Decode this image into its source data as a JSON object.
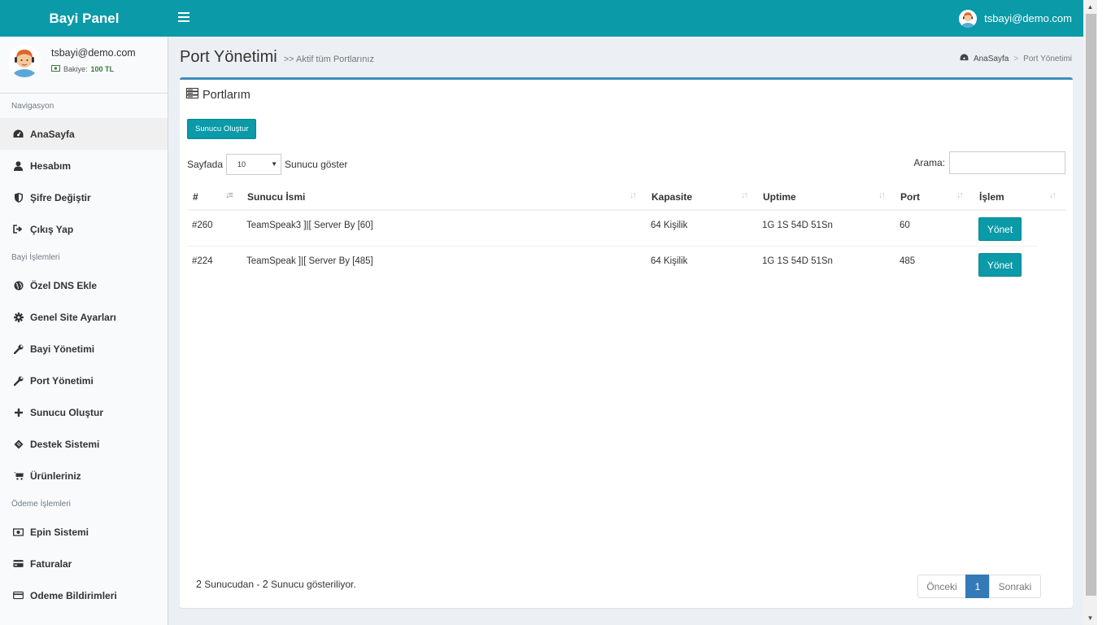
{
  "header": {
    "logo": "Bayi Panel",
    "user_email": "tsbayi@demo.com"
  },
  "sidebar": {
    "user": {
      "email": "tsbayi@demo.com",
      "balance_label": "Bakiye:",
      "balance_value": "100 TL"
    },
    "sections": [
      {
        "title": "Navigasyon",
        "items": [
          {
            "label": "AnaSayfa",
            "icon": "dashboard-icon",
            "active": true
          },
          {
            "label": "Hesabım",
            "icon": "user-icon"
          },
          {
            "label": "Şifre Değiştir",
            "icon": "shield-icon"
          },
          {
            "label": "Çıkış Yap",
            "icon": "sign-out-icon"
          }
        ]
      },
      {
        "title": "Bayi İşlemleri",
        "items": [
          {
            "label": "Özel DNS Ekle",
            "icon": "globe-icon"
          },
          {
            "label": "Genel Site Ayarları",
            "icon": "gear-icon"
          },
          {
            "label": "Bayi Yönetimi",
            "icon": "wrench-icon"
          },
          {
            "label": "Port Yönetimi",
            "icon": "wrench-icon"
          },
          {
            "label": "Sunucu Oluştur",
            "icon": "plus-icon"
          },
          {
            "label": "Destek Sistemi",
            "icon": "ticket-icon"
          },
          {
            "label": "Ürünleriniz",
            "icon": "cart-icon"
          }
        ]
      },
      {
        "title": "Ödeme İşlemleri",
        "items": [
          {
            "label": "Epin Sistemi",
            "icon": "money-icon"
          },
          {
            "label": "Faturalar",
            "icon": "credit-card-icon"
          },
          {
            "label": "Odeme Bildirimleri",
            "icon": "credit-card-icon"
          }
        ]
      }
    ]
  },
  "page": {
    "title": "Port Yönetimi",
    "subtitle": ">> Aktif tüm Portlarınız",
    "breadcrumb": {
      "home": "AnaSayfa",
      "separator": ">",
      "current": "Port Yönetimi"
    }
  },
  "box": {
    "title": "Portlarım",
    "create_button": "Sunucu Oluştur",
    "length_prefix": "Sayfada",
    "length_value": "10",
    "length_suffix": "Sunucu göster",
    "search_label": "Arama:",
    "search_value": ""
  },
  "table": {
    "columns": [
      "#",
      "Sunucu İsmi",
      "Kapasite",
      "Uptime",
      "Port",
      "İşlem"
    ],
    "rows": [
      {
        "id": "#260",
        "name": "TeamSpeak3 ]|[ Server By [60]",
        "capacity": "64 Kişilik",
        "uptime": "1G 1S 54D 51Sn",
        "port": "60",
        "action": "Yönet"
      },
      {
        "id": "#224",
        "name": "TeamSpeak ]|[ Server By [485]",
        "capacity": "64 Kişilik",
        "uptime": "1G 1S 54D 51Sn",
        "port": "485",
        "action": "Yönet"
      }
    ]
  },
  "footer": {
    "info_count1": "2",
    "info_text1": "Sunucudan -",
    "info_count2": "2",
    "info_text2": "Sunucu gösteriliyor.",
    "prev": "Önceki",
    "page": "1",
    "next": "Sonraki"
  },
  "colors": {
    "header": "#0a9aa8",
    "box_border": "#3c8dbc",
    "page_active": "#337ab7"
  }
}
